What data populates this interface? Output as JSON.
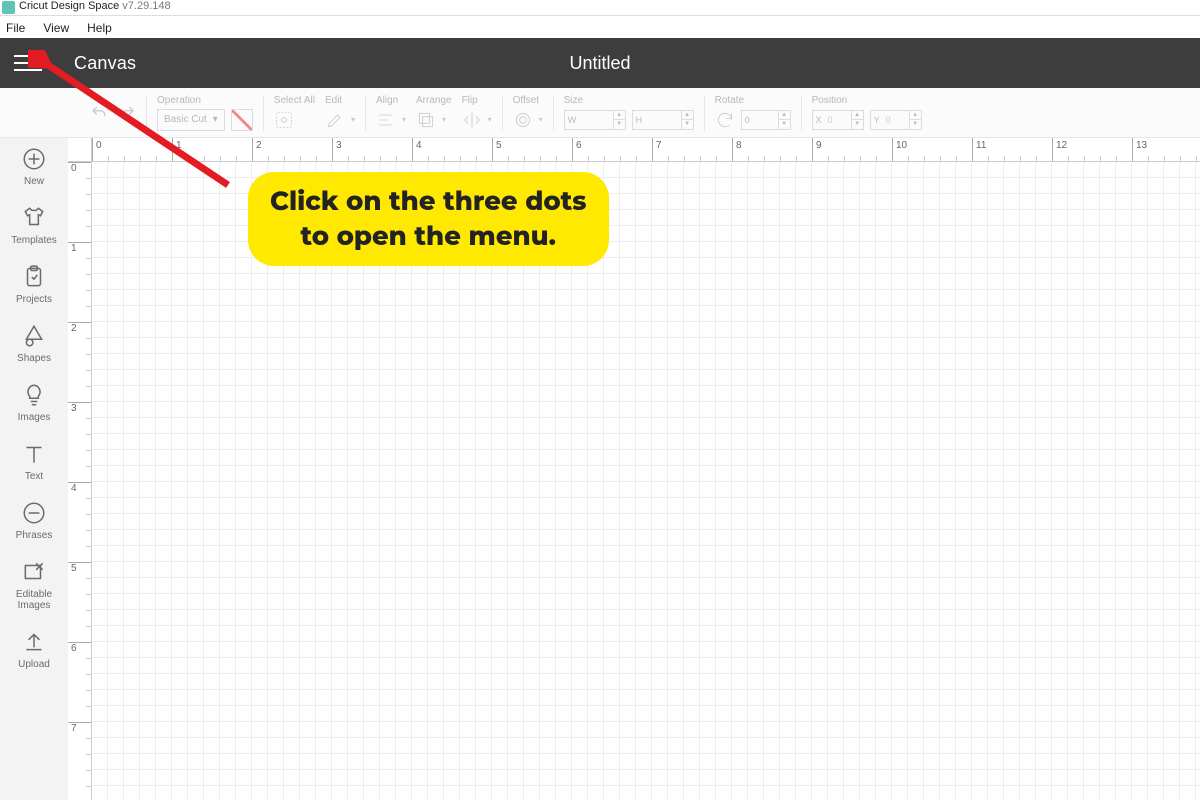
{
  "titlebar": {
    "appName": "Cricut Design Space",
    "version": "v7.29.148"
  },
  "menubar": {
    "file": "File",
    "view": "View",
    "help": "Help"
  },
  "header": {
    "section": "Canvas",
    "docTitle": "Untitled"
  },
  "toolbar": {
    "operation": {
      "label": "Operation",
      "value": "Basic Cut"
    },
    "selectAll": "Select All",
    "edit": "Edit",
    "align": "Align",
    "arrange": "Arrange",
    "flip": "Flip",
    "offset": "Offset",
    "size": {
      "label": "Size",
      "w": "W",
      "h": "H"
    },
    "rotate": {
      "label": "Rotate",
      "value": "0"
    },
    "position": {
      "label": "Position",
      "x": "X",
      "xv": "0",
      "y": "Y",
      "yv": "0"
    }
  },
  "sidebar": {
    "items": [
      {
        "label": "New"
      },
      {
        "label": "Templates"
      },
      {
        "label": "Projects"
      },
      {
        "label": "Shapes"
      },
      {
        "label": "Images"
      },
      {
        "label": "Text"
      },
      {
        "label": "Phrases"
      },
      {
        "label": "Editable Images"
      },
      {
        "label": "Upload"
      }
    ]
  },
  "ruler": {
    "horizMajors": [
      "0",
      "1",
      "2",
      "3",
      "4",
      "5",
      "6",
      "7",
      "8",
      "9",
      "10",
      "11",
      "12",
      "13"
    ],
    "vertMajors": [
      "0",
      "1",
      "2",
      "3",
      "4",
      "5",
      "6",
      "7"
    ]
  },
  "annotation": {
    "line1": "Click on the three dots",
    "line2": "to open the menu."
  }
}
